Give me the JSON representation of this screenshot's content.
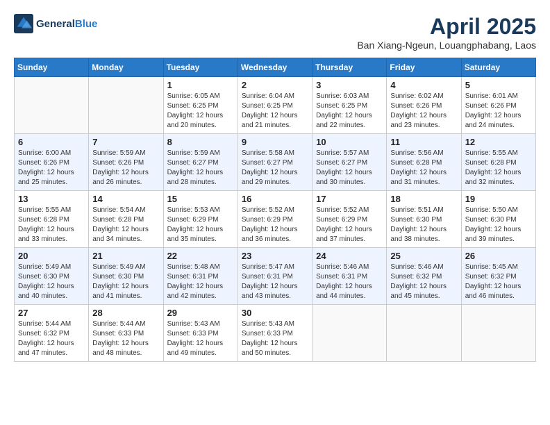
{
  "header": {
    "logo_line1": "General",
    "logo_line2": "Blue",
    "title": "April 2025",
    "subtitle": "Ban Xiang-Ngeun, Louangphabang, Laos"
  },
  "columns": [
    "Sunday",
    "Monday",
    "Tuesday",
    "Wednesday",
    "Thursday",
    "Friday",
    "Saturday"
  ],
  "weeks": [
    [
      {
        "num": "",
        "sunrise": "",
        "sunset": "",
        "daylight": ""
      },
      {
        "num": "",
        "sunrise": "",
        "sunset": "",
        "daylight": ""
      },
      {
        "num": "1",
        "sunrise": "Sunrise: 6:05 AM",
        "sunset": "Sunset: 6:25 PM",
        "daylight": "Daylight: 12 hours and 20 minutes."
      },
      {
        "num": "2",
        "sunrise": "Sunrise: 6:04 AM",
        "sunset": "Sunset: 6:25 PM",
        "daylight": "Daylight: 12 hours and 21 minutes."
      },
      {
        "num": "3",
        "sunrise": "Sunrise: 6:03 AM",
        "sunset": "Sunset: 6:25 PM",
        "daylight": "Daylight: 12 hours and 22 minutes."
      },
      {
        "num": "4",
        "sunrise": "Sunrise: 6:02 AM",
        "sunset": "Sunset: 6:26 PM",
        "daylight": "Daylight: 12 hours and 23 minutes."
      },
      {
        "num": "5",
        "sunrise": "Sunrise: 6:01 AM",
        "sunset": "Sunset: 6:26 PM",
        "daylight": "Daylight: 12 hours and 24 minutes."
      }
    ],
    [
      {
        "num": "6",
        "sunrise": "Sunrise: 6:00 AM",
        "sunset": "Sunset: 6:26 PM",
        "daylight": "Daylight: 12 hours and 25 minutes."
      },
      {
        "num": "7",
        "sunrise": "Sunrise: 5:59 AM",
        "sunset": "Sunset: 6:26 PM",
        "daylight": "Daylight: 12 hours and 26 minutes."
      },
      {
        "num": "8",
        "sunrise": "Sunrise: 5:59 AM",
        "sunset": "Sunset: 6:27 PM",
        "daylight": "Daylight: 12 hours and 28 minutes."
      },
      {
        "num": "9",
        "sunrise": "Sunrise: 5:58 AM",
        "sunset": "Sunset: 6:27 PM",
        "daylight": "Daylight: 12 hours and 29 minutes."
      },
      {
        "num": "10",
        "sunrise": "Sunrise: 5:57 AM",
        "sunset": "Sunset: 6:27 PM",
        "daylight": "Daylight: 12 hours and 30 minutes."
      },
      {
        "num": "11",
        "sunrise": "Sunrise: 5:56 AM",
        "sunset": "Sunset: 6:28 PM",
        "daylight": "Daylight: 12 hours and 31 minutes."
      },
      {
        "num": "12",
        "sunrise": "Sunrise: 5:55 AM",
        "sunset": "Sunset: 6:28 PM",
        "daylight": "Daylight: 12 hours and 32 minutes."
      }
    ],
    [
      {
        "num": "13",
        "sunrise": "Sunrise: 5:55 AM",
        "sunset": "Sunset: 6:28 PM",
        "daylight": "Daylight: 12 hours and 33 minutes."
      },
      {
        "num": "14",
        "sunrise": "Sunrise: 5:54 AM",
        "sunset": "Sunset: 6:28 PM",
        "daylight": "Daylight: 12 hours and 34 minutes."
      },
      {
        "num": "15",
        "sunrise": "Sunrise: 5:53 AM",
        "sunset": "Sunset: 6:29 PM",
        "daylight": "Daylight: 12 hours and 35 minutes."
      },
      {
        "num": "16",
        "sunrise": "Sunrise: 5:52 AM",
        "sunset": "Sunset: 6:29 PM",
        "daylight": "Daylight: 12 hours and 36 minutes."
      },
      {
        "num": "17",
        "sunrise": "Sunrise: 5:52 AM",
        "sunset": "Sunset: 6:29 PM",
        "daylight": "Daylight: 12 hours and 37 minutes."
      },
      {
        "num": "18",
        "sunrise": "Sunrise: 5:51 AM",
        "sunset": "Sunset: 6:30 PM",
        "daylight": "Daylight: 12 hours and 38 minutes."
      },
      {
        "num": "19",
        "sunrise": "Sunrise: 5:50 AM",
        "sunset": "Sunset: 6:30 PM",
        "daylight": "Daylight: 12 hours and 39 minutes."
      }
    ],
    [
      {
        "num": "20",
        "sunrise": "Sunrise: 5:49 AM",
        "sunset": "Sunset: 6:30 PM",
        "daylight": "Daylight: 12 hours and 40 minutes."
      },
      {
        "num": "21",
        "sunrise": "Sunrise: 5:49 AM",
        "sunset": "Sunset: 6:30 PM",
        "daylight": "Daylight: 12 hours and 41 minutes."
      },
      {
        "num": "22",
        "sunrise": "Sunrise: 5:48 AM",
        "sunset": "Sunset: 6:31 PM",
        "daylight": "Daylight: 12 hours and 42 minutes."
      },
      {
        "num": "23",
        "sunrise": "Sunrise: 5:47 AM",
        "sunset": "Sunset: 6:31 PM",
        "daylight": "Daylight: 12 hours and 43 minutes."
      },
      {
        "num": "24",
        "sunrise": "Sunrise: 5:46 AM",
        "sunset": "Sunset: 6:31 PM",
        "daylight": "Daylight: 12 hours and 44 minutes."
      },
      {
        "num": "25",
        "sunrise": "Sunrise: 5:46 AM",
        "sunset": "Sunset: 6:32 PM",
        "daylight": "Daylight: 12 hours and 45 minutes."
      },
      {
        "num": "26",
        "sunrise": "Sunrise: 5:45 AM",
        "sunset": "Sunset: 6:32 PM",
        "daylight": "Daylight: 12 hours and 46 minutes."
      }
    ],
    [
      {
        "num": "27",
        "sunrise": "Sunrise: 5:44 AM",
        "sunset": "Sunset: 6:32 PM",
        "daylight": "Daylight: 12 hours and 47 minutes."
      },
      {
        "num": "28",
        "sunrise": "Sunrise: 5:44 AM",
        "sunset": "Sunset: 6:33 PM",
        "daylight": "Daylight: 12 hours and 48 minutes."
      },
      {
        "num": "29",
        "sunrise": "Sunrise: 5:43 AM",
        "sunset": "Sunset: 6:33 PM",
        "daylight": "Daylight: 12 hours and 49 minutes."
      },
      {
        "num": "30",
        "sunrise": "Sunrise: 5:43 AM",
        "sunset": "Sunset: 6:33 PM",
        "daylight": "Daylight: 12 hours and 50 minutes."
      },
      {
        "num": "",
        "sunrise": "",
        "sunset": "",
        "daylight": ""
      },
      {
        "num": "",
        "sunrise": "",
        "sunset": "",
        "daylight": ""
      },
      {
        "num": "",
        "sunrise": "",
        "sunset": "",
        "daylight": ""
      }
    ]
  ]
}
